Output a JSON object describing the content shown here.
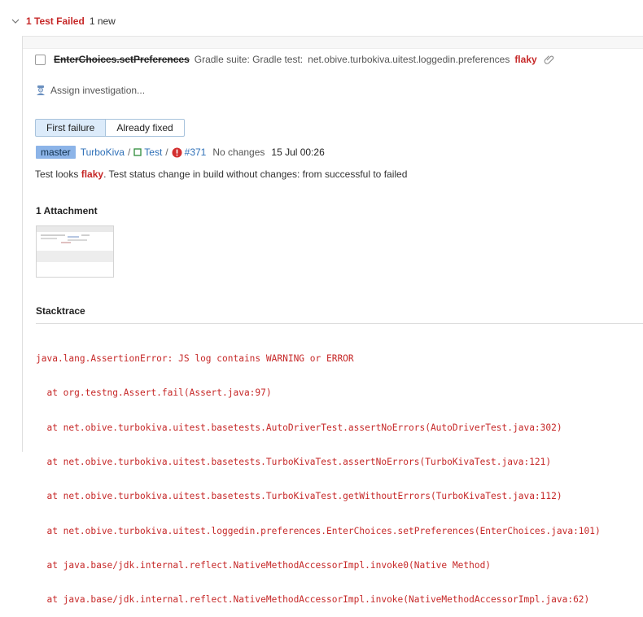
{
  "header": {
    "title": "1 Test Failed",
    "new_count": "1 new"
  },
  "test": {
    "name": "EnterChoices.setPreferences",
    "suite": "Gradle suite: Gradle test:",
    "package": "net.obive.turbokiva.uitest.loggedin.preferences",
    "flaky_tag": "flaky"
  },
  "assign": {
    "label": "Assign investigation..."
  },
  "tabs": [
    {
      "label": "First failure",
      "active": true
    },
    {
      "label": "Already fixed",
      "active": false
    }
  ],
  "build": {
    "branch": "master",
    "project": "TurboKiva",
    "build_config": "Test",
    "build_number": "#371",
    "changes": "No changes",
    "date": "15 Jul 00:26"
  },
  "flaky_note": {
    "prefix": "Test looks ",
    "word": "flaky",
    "suffix": ". Test status change in build without changes: from successful to failed"
  },
  "attachments": {
    "title": "1 Attachment"
  },
  "stacktrace": {
    "title": "Stacktrace",
    "lines": [
      "java.lang.AssertionError: JS log contains WARNING or ERROR",
      "  at org.testng.Assert.fail(Assert.java:97)",
      "  at net.obive.turbokiva.uitest.basetests.AutoDriverTest.assertNoErrors(AutoDriverTest.java:302)",
      "  at net.obive.turbokiva.uitest.basetests.TurboKivaTest.assertNoErrors(TurboKivaTest.java:121)",
      "  at net.obive.turbokiva.uitest.basetests.TurboKivaTest.getWithoutErrors(TurboKivaTest.java:112)",
      "  at net.obive.turbokiva.uitest.loggedin.preferences.EnterChoices.setPreferences(EnterChoices.java:101)",
      "  at java.base/jdk.internal.reflect.NativeMethodAccessorImpl.invoke0(Native Method)",
      "  at java.base/jdk.internal.reflect.NativeMethodAccessorImpl.invoke(NativeMethodAccessorImpl.java:62)"
    ]
  },
  "colors": {
    "error": "#c62828",
    "link": "#2d6fb7",
    "branch_bg": "#8cb4e8",
    "active_tab_bg": "#dcebfa"
  },
  "icons": [
    "chevron-down-icon",
    "paperclip-icon",
    "investigator-icon",
    "build-config-icon",
    "error-icon"
  ]
}
